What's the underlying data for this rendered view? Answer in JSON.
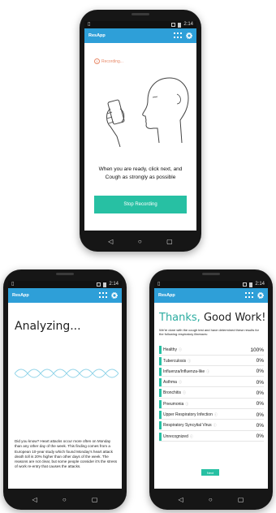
{
  "status": {
    "time": "2:14"
  },
  "app": {
    "title": "ResApp"
  },
  "recording": {
    "indicator": "Recording...",
    "instruction": "When you are ready, click next, and Cough as strongly as possible",
    "stop_label": "Stop Recording"
  },
  "analyzing": {
    "title": "Analyzing...",
    "fact": "Did you know? Heart attacks occur more often on Monday than any other day of the week. This finding comes from a European 10-year study which found Monday's heart attack death toll is 20% higher than other days of the week. The reasons are not clear, but some people consider it's the stress of work re-entry that causes the attacks."
  },
  "results": {
    "thanks": "Thanks,",
    "good_work": "Good Work!",
    "intro": "We're done with the cough test and have determined these results for the following respiratory illnesses:",
    "items": [
      {
        "name": "Healthy",
        "value": "100%"
      },
      {
        "name": "Tuberculosis",
        "value": "0%"
      },
      {
        "name": "Influenza/Influenza-like",
        "value": "0%"
      },
      {
        "name": "Asthma",
        "value": "0%"
      },
      {
        "name": "Bronchitis",
        "value": "0%"
      },
      {
        "name": "Pneumonia",
        "value": "0%"
      },
      {
        "name": "Upper Respiratory Infection",
        "value": "0%"
      },
      {
        "name": "Respiratory Syncytial Virus",
        "value": "0%"
      },
      {
        "name": "Unrecognized",
        "value": "0%"
      }
    ],
    "next_label": "Next"
  },
  "colors": {
    "appbar": "#2e9fd8",
    "accent": "#27c0a3",
    "thanks": "#2baca0"
  },
  "icons": [
    "grid-icon",
    "gear-icon",
    "microphone-icon",
    "info-icon",
    "back-icon",
    "home-icon",
    "recents-icon"
  ]
}
